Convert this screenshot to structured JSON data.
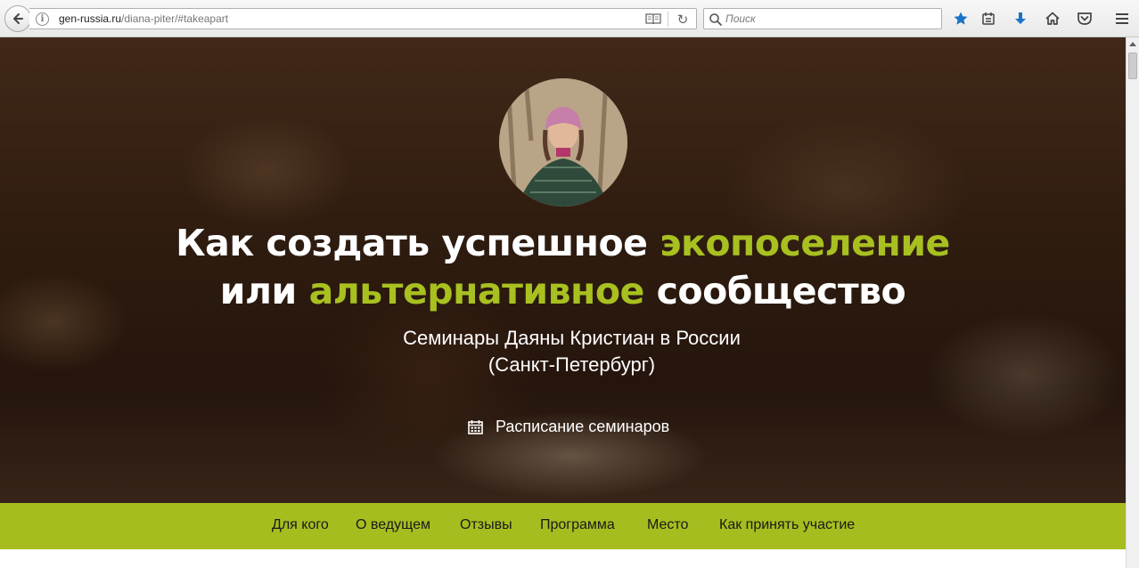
{
  "browser": {
    "url_host": "gen-russia.ru",
    "url_path": "/diana-piter/#takeapart",
    "search_placeholder": "Поиск",
    "icons": [
      "back-arrow-icon",
      "info-icon",
      "reader-view-icon",
      "reload-icon",
      "search-icon",
      "bookmark-star-icon",
      "bookmarks-list-icon",
      "downloads-icon",
      "home-icon",
      "pocket-icon",
      "menu-icon"
    ],
    "accent_star": "#1a73c9",
    "accent_download": "#1a73c9"
  },
  "hero": {
    "title_line1_plain": "Как создать успешное ",
    "title_line1_accent": "экопоселение",
    "title_line2_plain_start": "или ",
    "title_line2_accent": "альтернативное",
    "title_line2_plain_end": " сообщество",
    "subtitle_line1": "Семинары Даяны Кристиан в России",
    "subtitle_line2": "(Санкт-Петербург)",
    "schedule_label": "Расписание семинаров",
    "schedule_icon": "calendar-icon",
    "accent_color": "#a8c020"
  },
  "nav": {
    "background": "#a7bd1f",
    "items": [
      {
        "label": "Для кого"
      },
      {
        "label": "О ведущем"
      },
      {
        "label": "Отзывы"
      },
      {
        "label": "Программа"
      },
      {
        "label": "Место"
      },
      {
        "label": "Как принять участие"
      }
    ]
  }
}
